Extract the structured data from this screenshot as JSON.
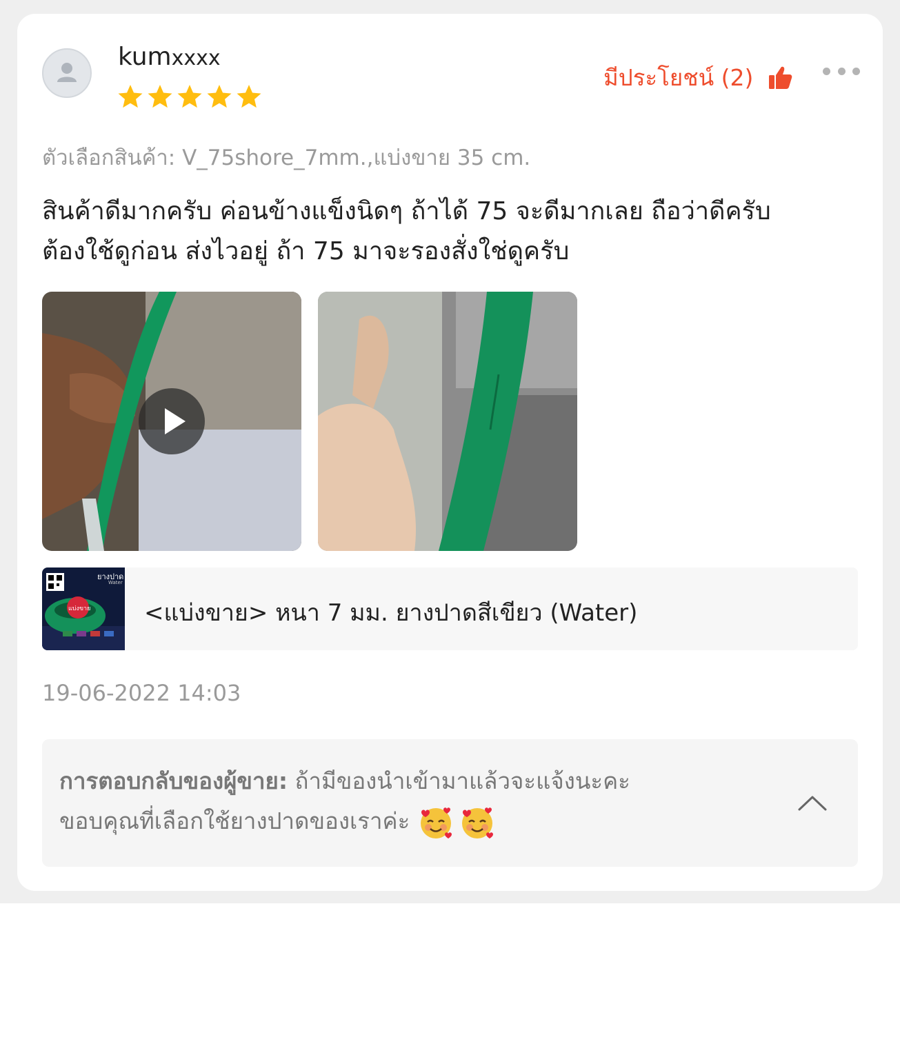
{
  "review": {
    "username_visible": "kum",
    "username_masked": "xxxx",
    "rating": 5,
    "rating_max": 5,
    "helpful_label": "มีประโยชน์ (2)",
    "variation": "ตัวเลือกสินค้า: V_75shore_7mm.,แบ่งขาย 35 cm.",
    "text_lines": [
      "สินค้าดีมากครับ ค่อนข้างแข็งนิดๆ ถ้าได้ 75 จะดีมากเลย ถือว่าดีครับ",
      "ต้องใช้ดูก่อน ส่งไวอยู่ ถ้า 75  มาจะรองสั่งใช่ดูครับ"
    ],
    "timestamp": "19-06-2022 14:03"
  },
  "media": [
    {
      "kind": "video",
      "icon": "play-icon"
    },
    {
      "kind": "photo"
    }
  ],
  "product": {
    "name": "<แบ่งขาย> หนา 7 มม. ยางปาดสีเขียว (Water)",
    "thumb_title": "ยางปาด",
    "thumb_subtitle": "Water",
    "thumb_badge": "แบ่งขาย"
  },
  "seller_reply": {
    "label": "การตอบกลับของผู้ขาย:",
    "line1": " ถ้ามีของนำเข้ามาแล้วจะแจ้งนะคะ",
    "line2": "ขอบคุณที่เลือกใช้ยางปาดของเราค่ะ "
  },
  "colors": {
    "accent": "#ee4d2d",
    "star": "#ffbd0f",
    "muted_text": "#9a9a9a",
    "green_product": "#11975c"
  },
  "icons": {
    "avatar": "user-avatar-icon",
    "like": "thumbs-up-icon",
    "more": "more-dots-icon",
    "collapse": "chevron-up-icon"
  }
}
